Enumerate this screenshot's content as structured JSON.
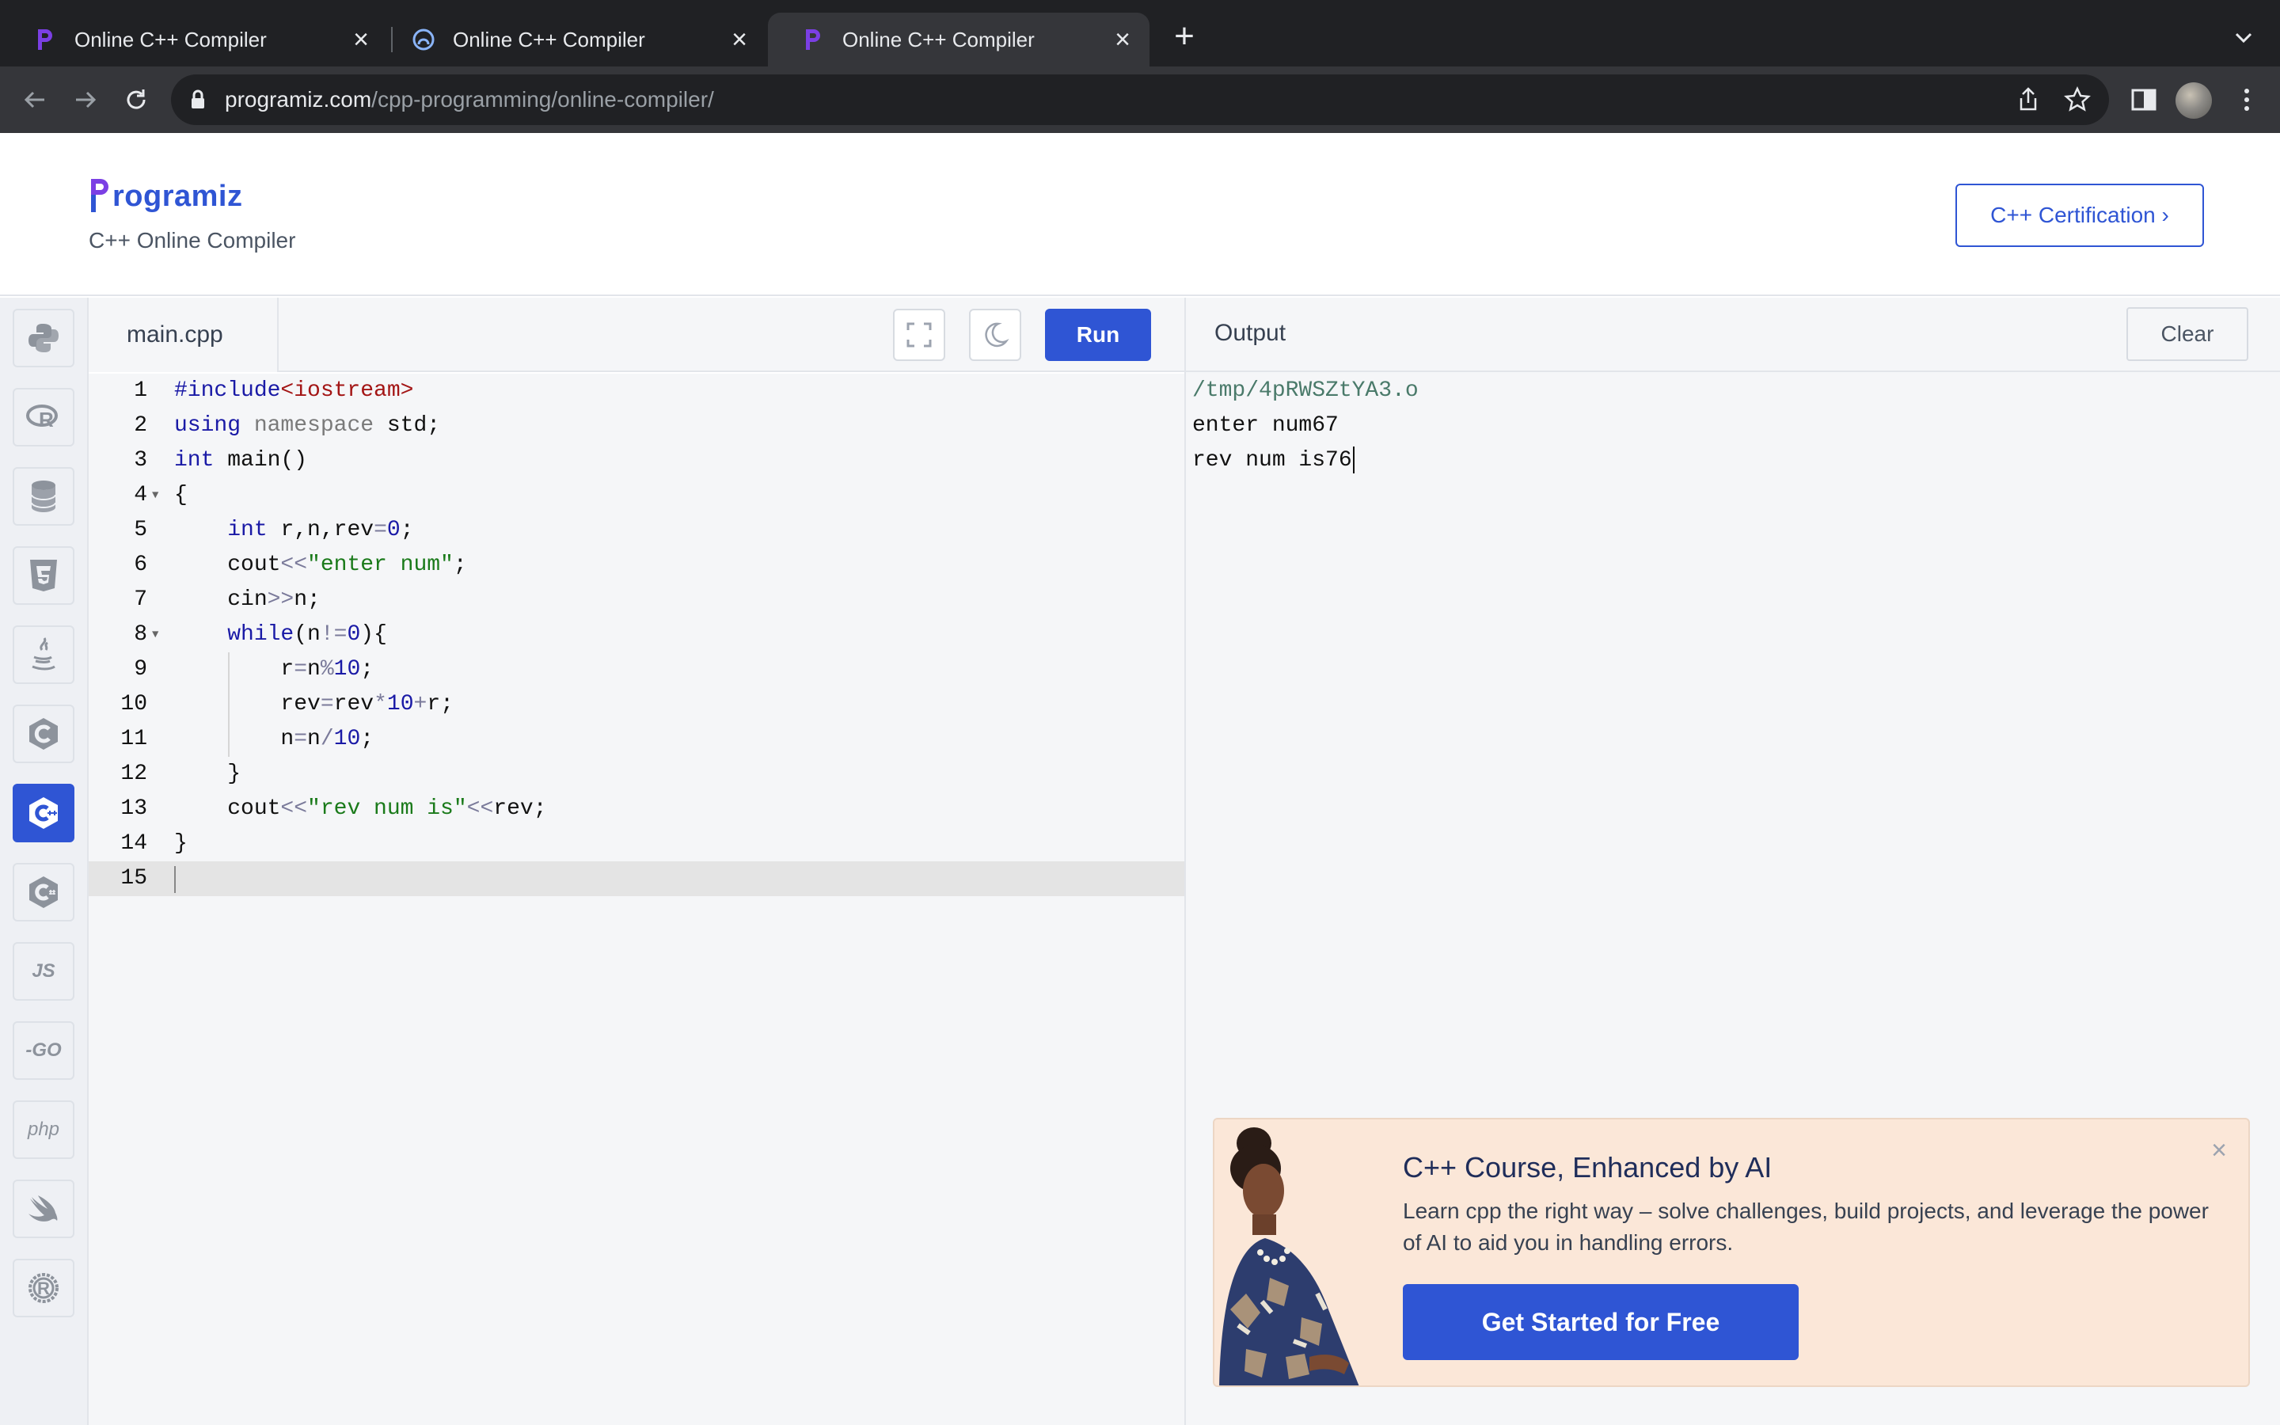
{
  "browser": {
    "tabs": [
      {
        "title": "Online C++ Compiler",
        "active": false
      },
      {
        "title": "Online C++ Compiler",
        "active": false
      },
      {
        "title": "Online C++ Compiler",
        "active": true
      }
    ],
    "url_domain": "programiz.com",
    "url_path": "/cpp-programming/online-compiler/"
  },
  "header": {
    "logo_text": "rogramiz",
    "subtitle": "C++ Online Compiler",
    "cert_button": "C++ Certification ›"
  },
  "sidebar": {
    "languages": [
      {
        "icon": "python-icon"
      },
      {
        "icon": "r-icon"
      },
      {
        "icon": "sql-icon"
      },
      {
        "icon": "html-icon"
      },
      {
        "icon": "java-icon"
      },
      {
        "icon": "c-icon"
      },
      {
        "icon": "cpp-icon",
        "active": true
      },
      {
        "icon": "csharp-icon"
      },
      {
        "icon": "js-icon",
        "label": "JS"
      },
      {
        "icon": "go-icon",
        "label": "-GO"
      },
      {
        "icon": "php-icon",
        "label": "php"
      },
      {
        "icon": "swift-icon"
      },
      {
        "icon": "rust-icon"
      }
    ]
  },
  "editor": {
    "filename": "main.cpp",
    "run_label": "Run",
    "line_numbers": [
      "1",
      "2",
      "3",
      "4",
      "5",
      "6",
      "7",
      "8",
      "9",
      "10",
      "11",
      "12",
      "13",
      "14",
      "15"
    ]
  },
  "output": {
    "title": "Output",
    "clear_label": "Clear",
    "lines": [
      "/tmp/4pRWSZtYA3.o",
      "enter num67",
      "rev num is76"
    ]
  },
  "promo": {
    "title": "C++ Course, Enhanced by AI",
    "description": "Learn cpp the right way – solve challenges, build projects, and leverage the power of AI to aid you in handling errors.",
    "cta": "Get Started for Free"
  },
  "colors": {
    "accent": "#2f55d4",
    "promo_bg": "#fbe7d8"
  }
}
